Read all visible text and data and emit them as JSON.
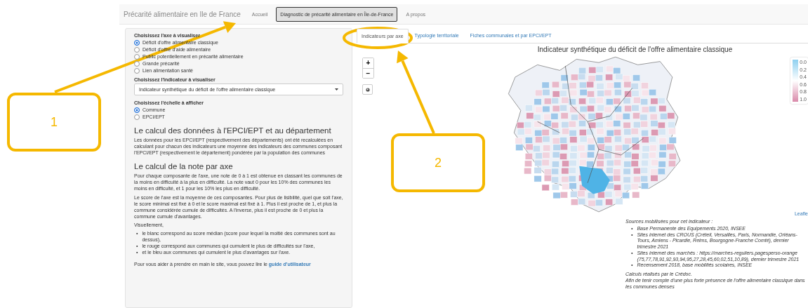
{
  "navbar": {
    "brand": "Précarité alimentaire en Ile de France",
    "tabs": [
      {
        "label": "Accueil",
        "selected": false
      },
      {
        "label": "Diagnostic de précarité alimentaire en Île-de-France",
        "selected": true
      },
      {
        "label": "A propos",
        "selected": false
      }
    ]
  },
  "sidebar": {
    "axis": {
      "label": "Choisissez l'axe à visualiser",
      "options": [
        {
          "label": "Déficit d'offre alimentaire classique",
          "selected": true
        },
        {
          "label": "Déficit d'offre d'aide alimentaire",
          "selected": false
        },
        {
          "label": "Public potentiellement en précarité alimentaire",
          "selected": false
        },
        {
          "label": "Grande précarité",
          "selected": false
        },
        {
          "label": "Lien alimentation santé",
          "selected": false
        }
      ]
    },
    "indicator": {
      "label": "Choisissez l'indicateur à visualiser",
      "value": "Indicateur synthétique du déficit de l'offre alimentaire classique"
    },
    "scale": {
      "label": "Choisissez l'échelle à afficher",
      "options": [
        {
          "label": "Commune",
          "selected": true
        },
        {
          "label": "EPCI/EPT",
          "selected": false
        }
      ]
    },
    "sections": [
      {
        "heading": "Le calcul des données à l'EPCI/EPT et au département",
        "paragraphs": [
          "Les données pour les EPCI/EPT (respectivement des départements) ont été recalculées en calculant pour chacun des indicateurs une moyenne des indicateurs des communes composant l'EPCI/EPT (respectivement le département) pondérée par la population des communes"
        ]
      },
      {
        "heading": "Le calcul de la note par axe",
        "paragraphs": [
          "Pour chaque composante de l'axe, une note de 0 à 1 est obtenue en classant les communes de la moins en difficulté à la plus en difficulté. La note vaut 0 pour les 10% des communes les moins en difficulté, et 1 pour les 10% les plus en difficulté.",
          "Le score de l'axe est la moyenne de ces composantes. Pour plus de lisibilité, quel que soit l'axe, le score minimal est fixé à 0 et le score maximal est fixé à 1. Plus il est proche de 1, et plus la commune considérée cumule de difficultés. A l'inverse, plus il est proche de 0 et plus la commune cumule d'avantages.",
          "Visuellement,"
        ],
        "bullets": [
          {
            "marker": "•",
            "text": "le blanc correspond au score médian (score pour lequel la moitié des communes sont au dessus),"
          },
          {
            "marker": "•",
            "text": "le rouge correspond aux communes qui cumulent le plus de difficultés sur l'axe,"
          },
          {
            "marker": "•",
            "text": "et le bleu aux communes qui cumulent le plus d'avantages sur l'axe."
          }
        ]
      }
    ],
    "help": {
      "text": "Pour vous aider à prendre en main le site, vous pouvez lire le",
      "link": "guide d'utilisateur"
    }
  },
  "main": {
    "tabs": [
      {
        "label": "Indicateurs par axe",
        "selected": true
      },
      {
        "label": "Typologie territoriale",
        "selected": false
      },
      {
        "label": "Fiches communales et par EPCI/EPT",
        "selected": false
      }
    ],
    "map": {
      "title": "Indicateur synthétique du déficit de l'offre alimentaire classique",
      "zoom_in": "+",
      "zoom_out": "−",
      "legend": [
        "0.0",
        "0.2",
        "0.4",
        "0.6",
        "0.8",
        "1.0"
      ],
      "attribution": "Leafle"
    },
    "sources": {
      "heading": "Sources mobilisées pour cet indicateur :",
      "items": [
        {
          "marker": "•",
          "text": "Base Permanente des Equipements 2020, INSEE"
        },
        {
          "marker": "•",
          "text": "Sites internet des CROUS (Créteil, Versailles, Paris, Normandie, Orléans-Tours, Amiens - Picardie, Reims, Bourgogne-Franche Comté), dernier trimestre 2021"
        },
        {
          "marker": "•",
          "text": "Sites internet des marchés : https://marches-reguliers.pagesperso-orange (75,77,78,91,92,93,94,95,27,28,45,60,02,51,10,89), dernier trimestre 2021"
        },
        {
          "marker": "•",
          "text": "Recensement 2018, base mobilités scolaires, INSEE"
        }
      ],
      "notes": [
        "Calculs réalisés par le Crédoc.",
        "Afin de tenir compte d'une plus forte présence de l'offre alimentaire classique dans les communes denses"
      ]
    }
  },
  "annotations": [
    {
      "label": "1"
    },
    {
      "label": "2"
    }
  ]
}
